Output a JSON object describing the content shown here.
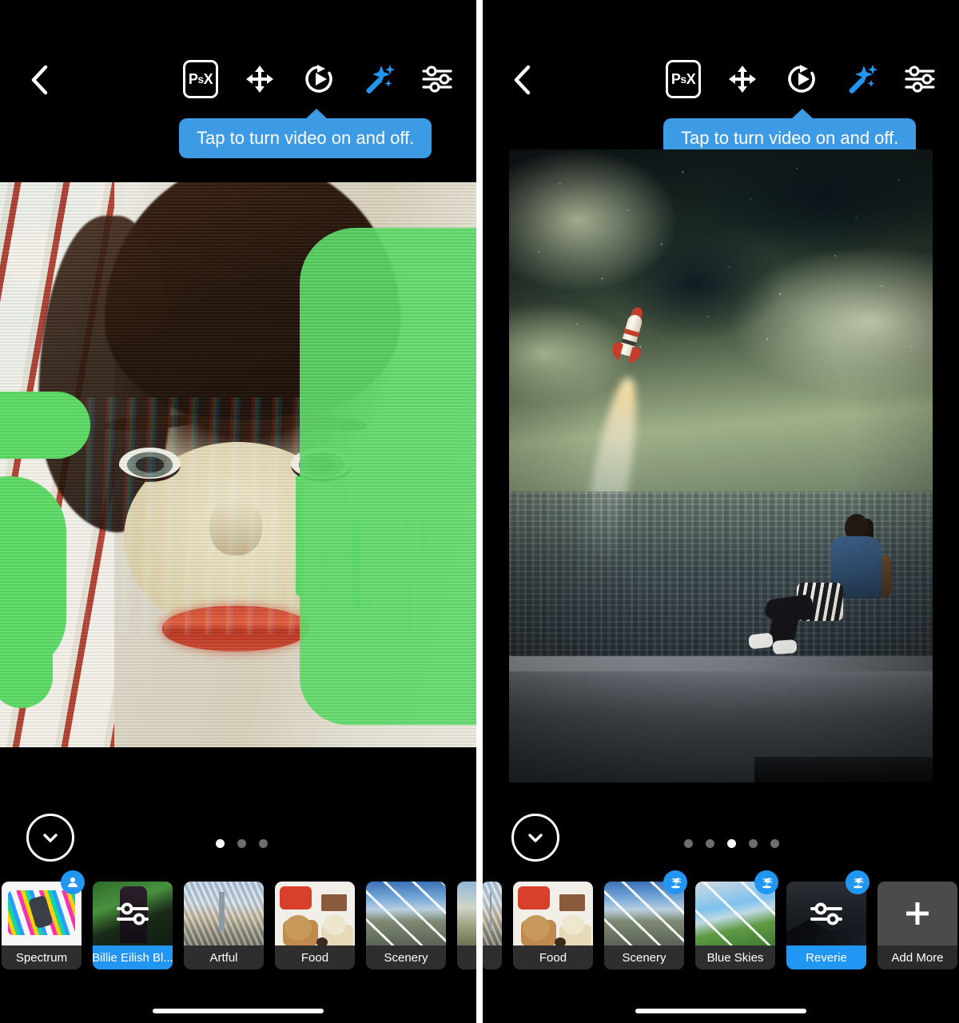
{
  "app": {
    "name": "Photoshop Express",
    "tooltip_color": "#3d9ae4",
    "accent_color": "#2196f3",
    "background_color": "#000000"
  },
  "panels": [
    {
      "id": "left",
      "toolbar": {
        "back_label": "‹",
        "icons": [
          {
            "name": "psx-logo-icon",
            "label": "PsX",
            "active": false
          },
          {
            "name": "move-icon",
            "label": "Move",
            "active": false
          },
          {
            "name": "video-toggle-icon",
            "label": "Video",
            "active": false
          },
          {
            "name": "magic-wand-icon",
            "label": "Looks",
            "active": true
          },
          {
            "name": "adjust-sliders-icon",
            "label": "Adjust",
            "active": false
          }
        ]
      },
      "tooltip": {
        "text": "Tap to turn video on and off."
      },
      "canvas": {
        "name": "portrait-glitch-artwork"
      },
      "collapse_button": {
        "name": "collapse-panel-button",
        "icon": "chevron-down-icon"
      },
      "pagination": {
        "total": 3,
        "active_index": 0
      },
      "looks": [
        {
          "label": "Spectrum",
          "selected": false,
          "badge": "person-icon",
          "art": "tm-spectrum",
          "overlay": null
        },
        {
          "label": "Billie Eilish Bl...",
          "selected": true,
          "badge": null,
          "art": "tm-billie",
          "overlay": "sliders-icon"
        },
        {
          "label": "Artful",
          "selected": false,
          "badge": null,
          "art": "tm-artful",
          "overlay": null
        },
        {
          "label": "Food",
          "selected": false,
          "badge": null,
          "art": "tm-food",
          "overlay": null
        },
        {
          "label": "Scenery",
          "selected": false,
          "badge": null,
          "art": "tm-scenery",
          "overlay": null
        },
        {
          "label": "",
          "selected": false,
          "badge": null,
          "art": "tm-edge",
          "overlay": null
        }
      ]
    },
    {
      "id": "right",
      "toolbar": {
        "back_label": "‹",
        "icons": [
          {
            "name": "psx-logo-icon",
            "label": "PsX",
            "active": false
          },
          {
            "name": "move-icon",
            "label": "Move",
            "active": false
          },
          {
            "name": "video-toggle-icon",
            "label": "Video",
            "active": false
          },
          {
            "name": "magic-wand-icon",
            "label": "Looks",
            "active": true
          },
          {
            "name": "adjust-sliders-icon",
            "label": "Adjust",
            "active": false
          }
        ]
      },
      "tooltip": {
        "text": "Tap to turn video on and off."
      },
      "canvas": {
        "name": "rocket-skyline-artwork"
      },
      "collapse_button": {
        "name": "collapse-panel-button",
        "icon": "chevron-down-icon"
      },
      "pagination": {
        "total": 5,
        "active_index": 2
      },
      "looks": [
        {
          "label": "",
          "selected": false,
          "badge": null,
          "art": "tm-artful",
          "overlay": null
        },
        {
          "label": "Food",
          "selected": false,
          "badge": null,
          "art": "tm-food",
          "overlay": null
        },
        {
          "label": "Scenery",
          "selected": false,
          "badge": "palm-tree-icon",
          "art": "tm-scenery",
          "overlay": null
        },
        {
          "label": "Blue Skies",
          "selected": false,
          "badge": "palm-tree-icon",
          "art": "tm-blueskies",
          "overlay": null
        },
        {
          "label": "Reverie",
          "selected": true,
          "badge": "palm-tree-icon",
          "art": "tm-reverie",
          "overlay": "sliders-icon"
        },
        {
          "label": "Add More",
          "selected": false,
          "badge": null,
          "art": "add-more",
          "overlay": "plus-icon"
        }
      ]
    }
  ]
}
